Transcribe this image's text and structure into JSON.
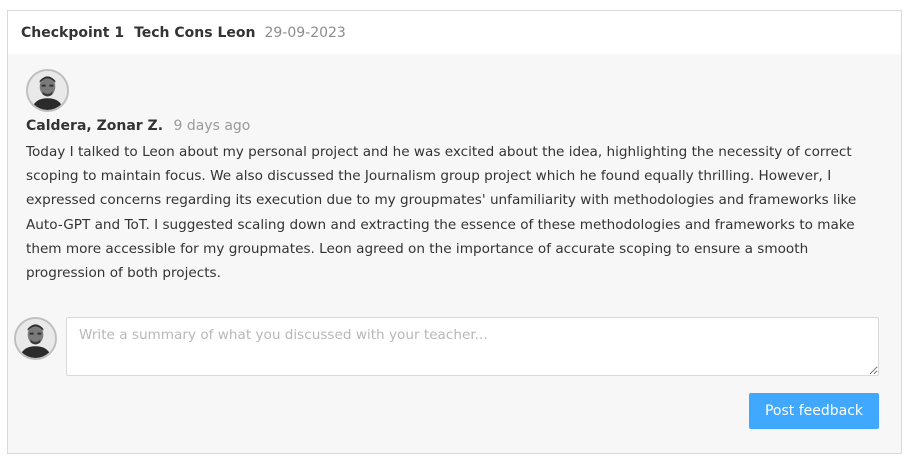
{
  "header": {
    "checkpoint": "Checkpoint 1",
    "title": "Tech Cons Leon",
    "date": "29-09-2023"
  },
  "comment": {
    "avatar_icon": "user-avatar",
    "author": "Caldera, Zonar Z.",
    "time_ago": "9 days ago",
    "body": "Today I talked to Leon about my personal project and he was excited about the idea, highlighting the necessity of correct scoping to maintain focus. We also discussed the Journalism group project which he found equally thrilling. However, I expressed concerns regarding its execution due to my groupmates' unfamiliarity with methodologies and frameworks like Auto-GPT and ToT. I suggested scaling down and extracting the essence of these methodologies and frameworks to make them more accessible for my groupmates. Leon agreed on the importance of accurate scoping to ensure a smooth progression of both projects."
  },
  "reply": {
    "avatar_icon": "user-avatar",
    "value": "",
    "placeholder": "Write a summary of what you discussed with your teacher...",
    "button_label": "Post feedback"
  },
  "colors": {
    "accent": "#40a9ff",
    "panel_background": "#f7f7f7",
    "border": "#d9d9d9",
    "muted_text": "#8c8c8c"
  }
}
